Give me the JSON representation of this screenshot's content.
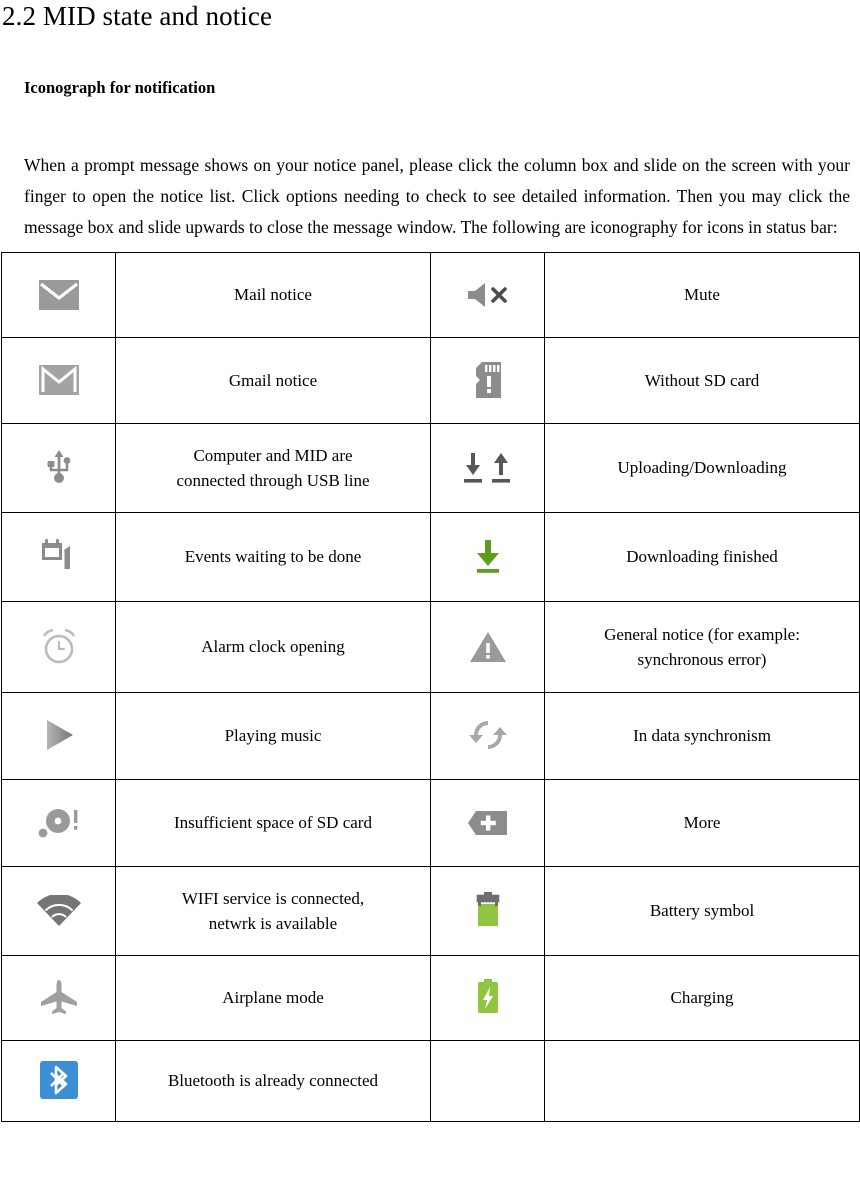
{
  "document": {
    "section_heading": "2.2 MID state and notice",
    "sub_heading": "Iconograph for notification",
    "paragraph": "When a prompt message shows on your notice panel, please click the column box and slide on the screen with your finger to open the notice list. Click options needing to check to see detailed information. Then you may click the message box and slide upwards to close the message window. The following are iconography for icons in status bar:"
  },
  "colors": {
    "icon_gray": "#9a9a9a",
    "icon_dark_gray": "#6e6e6e",
    "icon_light_gray": "#b9b9b9",
    "green": "#77b41f",
    "green_bright": "#8ec63f",
    "bluetooth_blue": "#3b8fd4",
    "border": "#000000"
  },
  "table": {
    "rows": [
      {
        "left": {
          "icon": "mail-icon",
          "label_line1": "Mail notice",
          "label_line2": ""
        },
        "right": {
          "icon": "mute-icon",
          "label_line1": "Mute",
          "label_line2": ""
        }
      },
      {
        "left": {
          "icon": "gmail-icon",
          "label_line1": "Gmail notice",
          "label_line2": ""
        },
        "right": {
          "icon": "no-sd-card-icon",
          "label_line1": "Without SD card",
          "label_line2": ""
        }
      },
      {
        "left": {
          "icon": "usb-icon",
          "label_line1": "Computer and MID are",
          "label_line2": "connected through USB line"
        },
        "right": {
          "icon": "upload-download-icon",
          "label_line1": "Uploading/Downloading",
          "label_line2": ""
        }
      },
      {
        "left": {
          "icon": "calendar-event-icon",
          "label_line1": "Events waiting to be done",
          "label_line2": ""
        },
        "right": {
          "icon": "download-done-icon",
          "label_line1": "Downloading finished",
          "label_line2": ""
        }
      },
      {
        "left": {
          "icon": "alarm-clock-icon",
          "label_line1": "Alarm clock opening",
          "label_line2": ""
        },
        "right": {
          "icon": "warning-icon",
          "label_line1": "General notice (for example:",
          "label_line2": "synchronous error)"
        }
      },
      {
        "left": {
          "icon": "play-icon",
          "label_line1": "Playing music",
          "label_line2": ""
        },
        "right": {
          "icon": "sync-problem-icon",
          "label_line1": "In data synchronism",
          "label_line2": ""
        }
      },
      {
        "left": {
          "icon": "sd-card-full-icon",
          "label_line1": "Insufficient space of SD card",
          "label_line2": ""
        },
        "right": {
          "icon": "more-icon",
          "label_line1": "More",
          "label_line2": ""
        }
      },
      {
        "left": {
          "icon": "wifi-icon",
          "label_line1": "WIFI service is connected,",
          "label_line2": "netwrk is available"
        },
        "right": {
          "icon": "battery-icon",
          "label_line1": "Battery symbol",
          "label_line2": ""
        }
      },
      {
        "left": {
          "icon": "airplane-icon",
          "label_line1": "Airplane mode",
          "label_line2": ""
        },
        "right": {
          "icon": "battery-charging-icon",
          "label_line1": "Charging",
          "label_line2": ""
        }
      },
      {
        "left": {
          "icon": "bluetooth-icon",
          "label_line1": "Bluetooth is already connected",
          "label_line2": ""
        },
        "right": {
          "icon": "",
          "label_line1": "",
          "label_line2": ""
        }
      }
    ]
  }
}
